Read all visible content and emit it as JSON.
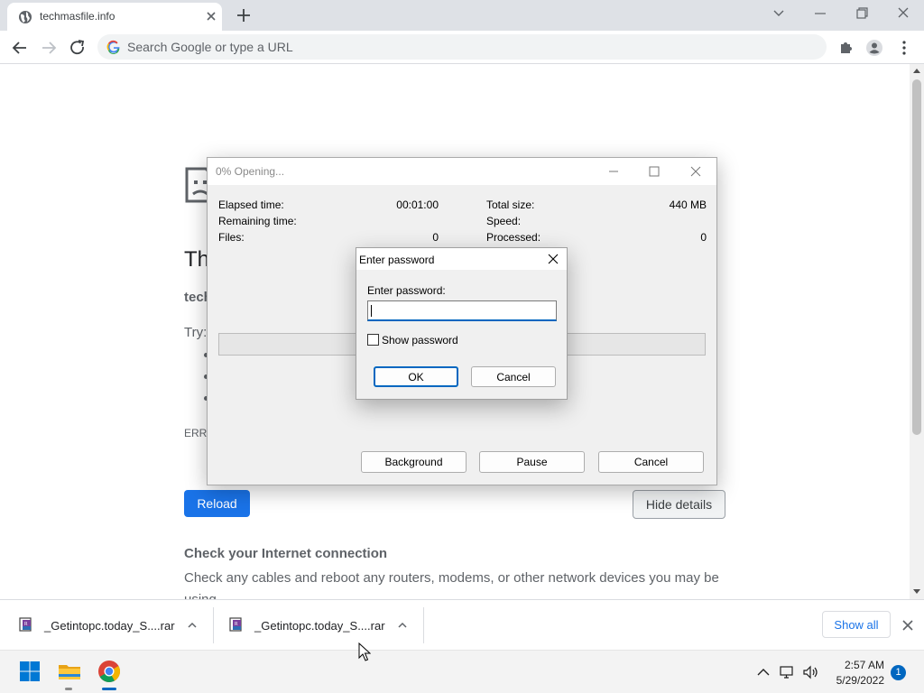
{
  "browser": {
    "tab_title": "techmasfile.info",
    "omnibox_placeholder": "Search Google or type a URL"
  },
  "page": {
    "heading": "Th",
    "host": "tech",
    "try_label": "Try:",
    "error_code": "ERR_",
    "reload_label": "Reload",
    "hide_details_label": "Hide details",
    "check_heading": "Check your Internet connection",
    "check_body": "Check any cables and reboot any routers, modems, or other network devices you may be using."
  },
  "rar_window": {
    "title": "0% Opening...",
    "elapsed_label": "Elapsed time:",
    "elapsed_value": "00:01:00",
    "remaining_label": "Remaining time:",
    "files_label": "Files:",
    "files_value": "0",
    "total_size_label": "Total size:",
    "total_size_value": "440 MB",
    "speed_label": "Speed:",
    "processed_label": "Processed:",
    "processed_value": "0",
    "progress_fraction": 0,
    "background_label": "Background",
    "pause_label": "Pause",
    "cancel_label": "Cancel"
  },
  "password_dialog": {
    "title": "Enter password",
    "field_label": "Enter password:",
    "field_value": "",
    "show_password_label": "Show password",
    "show_password_checked": false,
    "ok_label": "OK",
    "cancel_label": "Cancel"
  },
  "downloads": {
    "items": [
      {
        "name": "_Getintopc.today_S....rar",
        "icon": "winrar-file-icon"
      },
      {
        "name": "_Getintopc.today_S....rar",
        "icon": "winrar-file-icon"
      }
    ],
    "show_all_label": "Show all"
  },
  "taskbar": {
    "time": "2:57 AM",
    "date": "5/29/2022",
    "notification_count": "1"
  },
  "colors": {
    "accent_blue": "#1a73e8",
    "windows_blue": "#0067c0",
    "chrome_frame": "#dee1e6"
  }
}
